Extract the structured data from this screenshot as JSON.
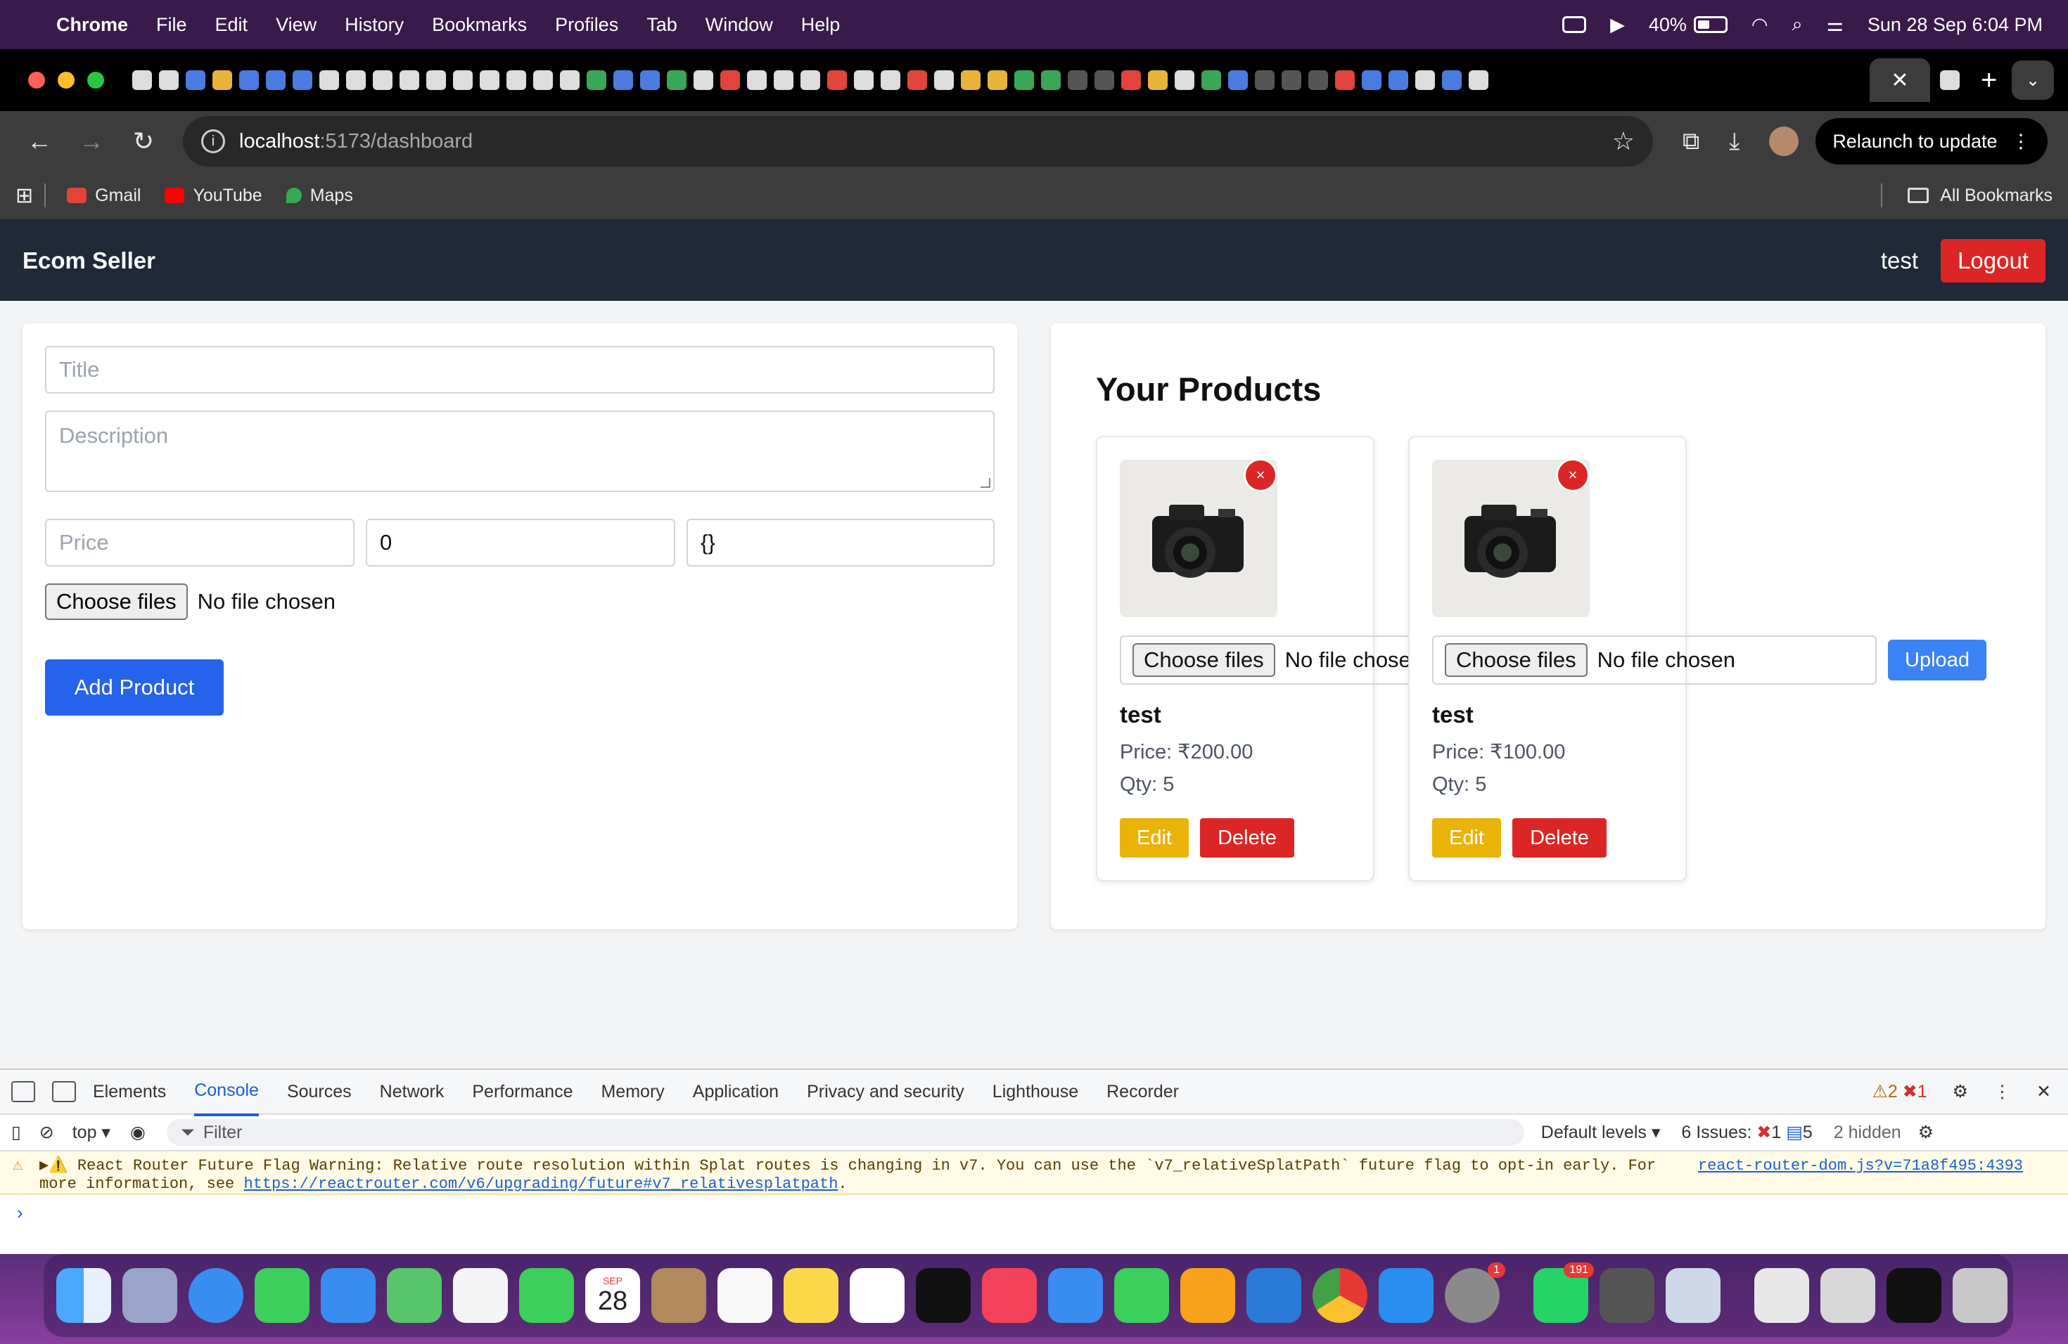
{
  "menubar": {
    "app": "Chrome",
    "items": [
      "File",
      "Edit",
      "View",
      "History",
      "Bookmarks",
      "Profiles",
      "Tab",
      "Window",
      "Help"
    ],
    "battery": "40%",
    "datetime": "Sun 28 Sep  6:04 PM"
  },
  "browser": {
    "url_host": "localhost",
    "url_path": ":5173/dashboard",
    "relaunch": "Relaunch to update",
    "bookmarks": [
      "Gmail",
      "YouTube",
      "Maps"
    ],
    "all_bookmarks": "All Bookmarks"
  },
  "app": {
    "brand": "Ecom Seller",
    "user": "test",
    "logout": "Logout"
  },
  "form": {
    "title_placeholder": "Title",
    "description_placeholder": "Description",
    "price_placeholder": "Price",
    "quantity_value": "0",
    "attributes_value": "{}",
    "choose_files": "Choose files",
    "no_file": "No file chosen",
    "add_button": "Add Product"
  },
  "products": {
    "heading": "Your Products",
    "remove_glyph": "×",
    "choose_files": "Choose files",
    "no_file": "No file chosen",
    "upload": "Upload",
    "edit": "Edit",
    "delete": "Delete",
    "items": [
      {
        "name": "test",
        "price": "Price: ₹200.00",
        "qty": "Qty: 5"
      },
      {
        "name": "test",
        "price": "Price: ₹100.00",
        "qty": "Qty: 5"
      }
    ]
  },
  "devtools": {
    "tabs": [
      "Elements",
      "Console",
      "Sources",
      "Network",
      "Performance",
      "Memory",
      "Application",
      "Privacy and security",
      "Lighthouse",
      "Recorder"
    ],
    "active_tab": "Console",
    "warnings": "2",
    "errors": "1",
    "context": "top ▾",
    "filter": "Filter",
    "levels": "Default levels ▾",
    "issues": "6 Issues:",
    "issue_errors": "1",
    "issue_info": "5",
    "hidden": "2 hidden",
    "warning_text": "▶⚠️ React Router Future Flag Warning: Relative route resolution within Splat routes is changing in v7. You can use the `v7_relativeSplatPath` future flag to opt-in early. For",
    "warning_text2": "more information, see ",
    "warning_link": "https://reactrouter.com/v6/upgrading/future#v7_relativesplatpath",
    "warning_source": "react-router-dom.js?v=71a8f495:4393"
  },
  "dock": {
    "calendar_month": "SEP",
    "calendar_day": "28",
    "whatsapp_badge": "191",
    "settings_badge": "1"
  }
}
